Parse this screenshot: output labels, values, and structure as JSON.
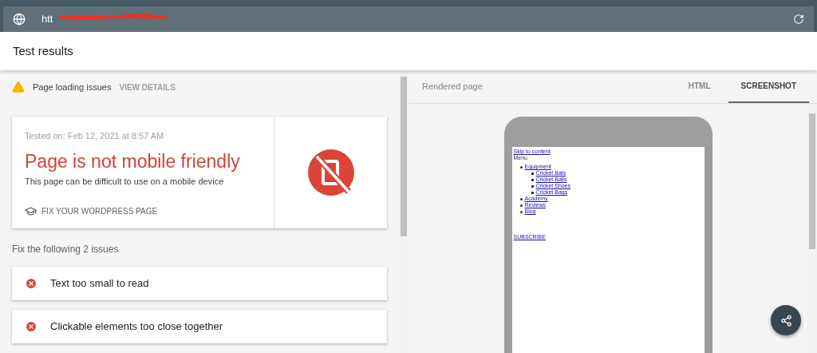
{
  "address_bar": {
    "url": "htt"
  },
  "header": {
    "title": "Test results"
  },
  "left": {
    "notice": {
      "text": "Page loading issues",
      "action": "VIEW DETAILS"
    },
    "result": {
      "tested_on": "Tested on: Feb 12, 2021 at 8:57 AM",
      "title": "Page is not mobile friendly",
      "description": "This page can be difficult to use on a mobile device",
      "link": "FIX YOUR WORDPRESS PAGE"
    },
    "issues_heading": "Fix the following 2 issues",
    "issues": [
      "Text too small to read",
      "Clickable elements too close together"
    ]
  },
  "right": {
    "title": "Rendered page",
    "tabs": [
      {
        "label": "HTML",
        "selected": false
      },
      {
        "label": "SCREENSHOT",
        "selected": true
      }
    ],
    "preview": {
      "skip_link": "Skip to content",
      "menu": "Menu",
      "nav": [
        {
          "label": "Equipment",
          "children": [
            {
              "label": "Cricket Bats"
            },
            {
              "label": "Cricket Balls"
            },
            {
              "label": "Cricket Shoes"
            },
            {
              "label": "Cricket Bags"
            }
          ]
        },
        {
          "label": "Academy"
        },
        {
          "label": "Reviews"
        },
        {
          "label": "Blog"
        }
      ],
      "subscribe": "SUBSCRIBE"
    }
  }
}
